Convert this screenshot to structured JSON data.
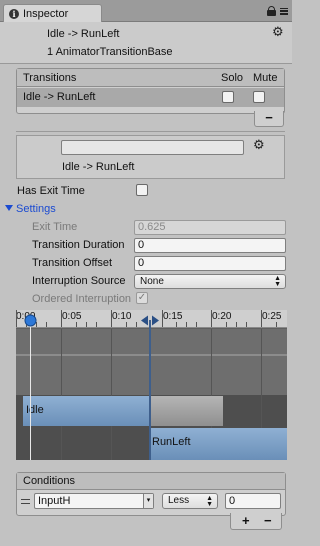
{
  "tab": {
    "label": "Inspector"
  },
  "header": {
    "title": "Idle -> RunLeft",
    "subtitle": "1 AnimatorTransitionBase"
  },
  "transitions": {
    "header": "Transitions",
    "solo_label": "Solo",
    "mute_label": "Mute",
    "rows": [
      {
        "label": "Idle -> RunLeft",
        "solo": false,
        "mute": false
      }
    ],
    "remove_label": "−"
  },
  "preview": {
    "label": "Idle -> RunLeft"
  },
  "has_exit_time": {
    "label": "Has Exit Time",
    "checked": false
  },
  "settings": {
    "label": "Settings",
    "exit_time": {
      "label": "Exit Time",
      "value": "0.625"
    },
    "transition_duration": {
      "label": "Transition Duration",
      "value": "0"
    },
    "transition_offset": {
      "label": "Transition Offset",
      "value": "0"
    },
    "interruption_source": {
      "label": "Interruption Source",
      "value": "None"
    },
    "ordered_interruption": {
      "label": "Ordered Interruption",
      "checked": true
    }
  },
  "timeline": {
    "ticks": [
      "0:00",
      "0:05",
      "0:10",
      "0:15",
      "0:20",
      "0:25"
    ],
    "bars": {
      "source": "Idle",
      "destination": "RunLeft"
    }
  },
  "conditions": {
    "header": "Conditions",
    "items": [
      {
        "parameter": "InputH",
        "mode": "Less",
        "value": "0"
      }
    ],
    "add_label": "+",
    "remove_label": "−"
  },
  "colors": {
    "accent": "#1b4bd1",
    "clip_bar": "#7a9cc4",
    "panel": "#c2c2c2"
  }
}
